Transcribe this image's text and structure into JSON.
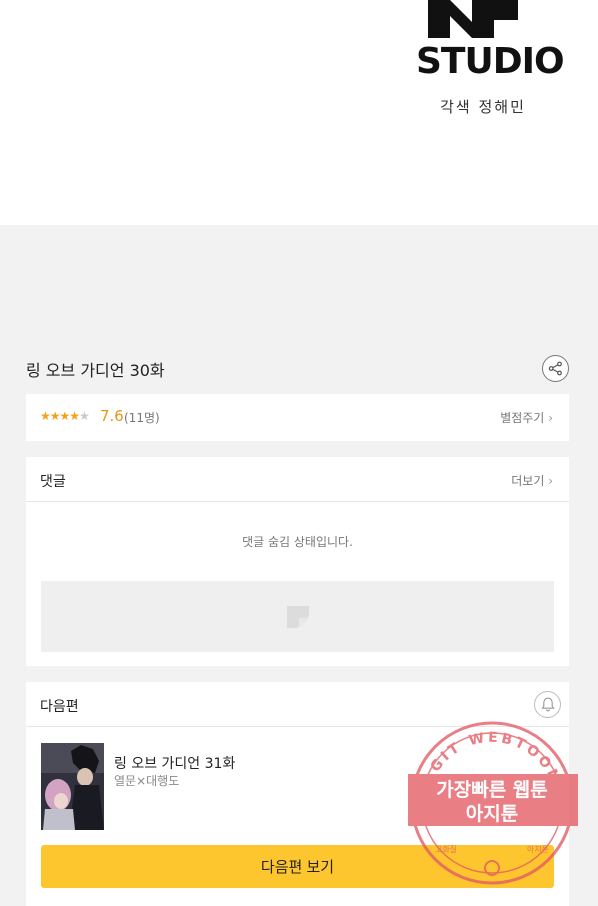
{
  "hero": {
    "logo_text": "STUDIO",
    "logo_sub": "각색 정해민"
  },
  "episode": {
    "title": "링 오브 가디언 30화"
  },
  "rating": {
    "stars_filled": 4,
    "stars_total": 5,
    "score": "7.6",
    "count": "(11명)",
    "rate_link": "별점주기"
  },
  "comments": {
    "header": "댓글",
    "more": "더보기",
    "hidden_message": "댓글 숨김 상태입니다."
  },
  "next": {
    "header": "다음편",
    "title": "링 오브 가디언 31화",
    "author": "열문×대행도",
    "button": "다음편 보기"
  },
  "watermark": {
    "arc_text": "AGIT WEBTOON",
    "line1": "가장빠른 웹툰",
    "line2": "아지툰",
    "bottom_left": "고화질",
    "bottom_right": "아지툰"
  },
  "colors": {
    "accent_yellow": "#fdc62e",
    "star": "#f3a21a",
    "watermark_red": "#e35a63"
  },
  "icons": [
    "share-icon",
    "chevron-right-icon",
    "image-placeholder-icon",
    "bell-icon"
  ]
}
